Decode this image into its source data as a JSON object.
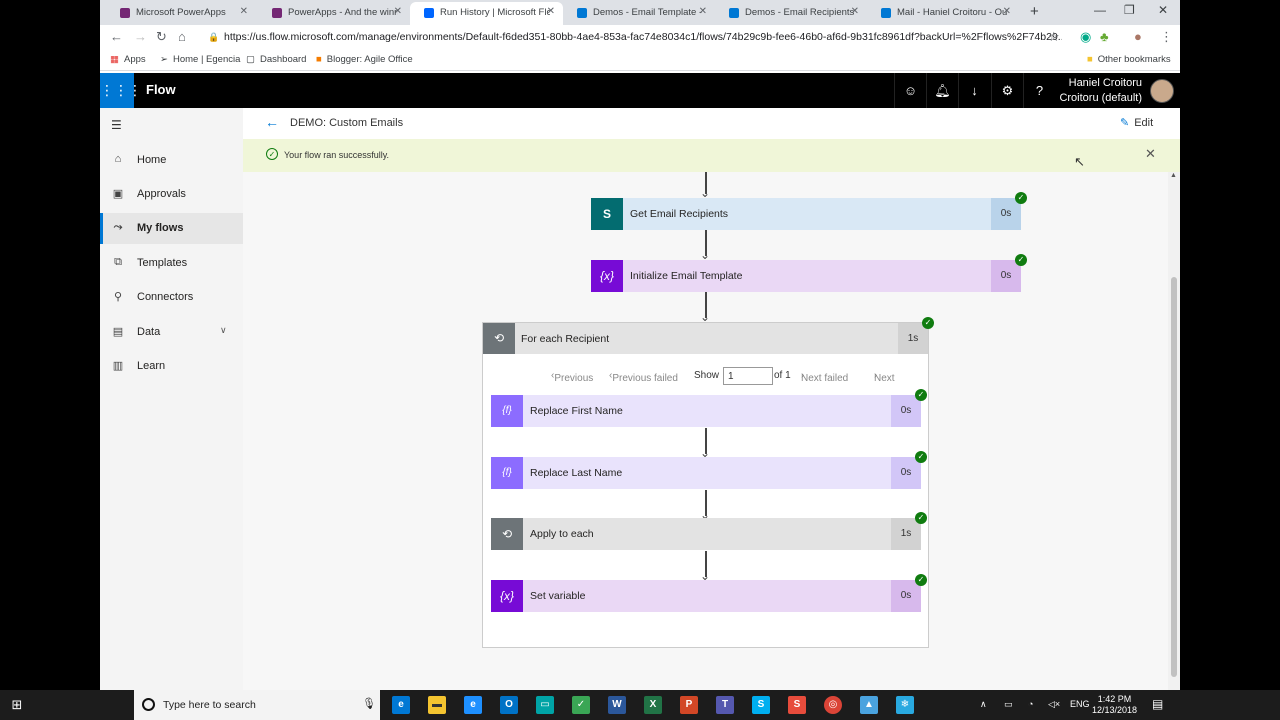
{
  "browser": {
    "tabs": [
      {
        "title": "Microsoft PowerApps",
        "color": "#742774"
      },
      {
        "title": "PowerApps - And the winne",
        "color": "#742774"
      },
      {
        "title": "Run History | Microsoft Flov",
        "color": "#0066ff",
        "active": true
      },
      {
        "title": "Demos - Email Template - A",
        "color": "#0078d4"
      },
      {
        "title": "Demos - Email Recipients",
        "color": "#0078d4"
      },
      {
        "title": "Mail - Haniel Croitoru - Out",
        "color": "#0078d4"
      }
    ],
    "new_tab": "+",
    "url": "https://us.flow.microsoft.com/manage/environments/Default-f6ded351-80bb-4ae4-853a-fac74e8034c1/flows/74b29c9b-fee6-46b0-af6d-9b31fc8961df?backUrl=%2Fflows%2F74b29...",
    "bookmarks": {
      "apps": "Apps",
      "home_egencia": "Home | Egencia",
      "dashboard": "Dashboard",
      "blogger": "Blogger: Agile Office",
      "other": "Other bookmarks"
    }
  },
  "header": {
    "app_name": "Flow",
    "user_name_line1": "Haniel Croitoru",
    "user_name_line2": "Croitoru (default)"
  },
  "nav": {
    "items": [
      {
        "label": "Home",
        "icon": "home-icon"
      },
      {
        "label": "Approvals",
        "icon": "approvals-icon"
      },
      {
        "label": "My flows",
        "icon": "flows-icon",
        "selected": true
      },
      {
        "label": "Templates",
        "icon": "templates-icon"
      },
      {
        "label": "Connectors",
        "icon": "connectors-icon"
      },
      {
        "label": "Data",
        "icon": "data-icon",
        "expandable": true
      },
      {
        "label": "Learn",
        "icon": "learn-icon"
      }
    ]
  },
  "main": {
    "title": "DEMO: Custom Emails",
    "edit_label": "Edit",
    "banner_message": "Your flow ran successfully."
  },
  "flow": {
    "steps": [
      {
        "label": "Get Email Recipients",
        "duration": "0s",
        "icon": "sharepoint-icon",
        "icon_color": "#036c70",
        "bg": "#d9e8f5",
        "dur_bg": "#b9d3ea"
      },
      {
        "label": "Initialize Email Template",
        "duration": "0s",
        "icon": "variable-icon",
        "icon_color": "#770bd6",
        "bg": "#ead8f5",
        "dur_bg": "#d7b9ec"
      }
    ],
    "foreach": {
      "label": "For each Recipient",
      "duration": "1s",
      "pager": {
        "previous": "Previous",
        "previous_failed": "Previous failed",
        "show": "Show",
        "page": "1",
        "of": "of 1",
        "next_failed": "Next failed",
        "next": "Next"
      },
      "steps": [
        {
          "label": "Replace First Name",
          "duration": "0s",
          "icon": "expression-icon",
          "icon_color": "#8c6cff",
          "bg": "#e9e3fc",
          "dur_bg": "#d2c6f7"
        },
        {
          "label": "Replace Last Name",
          "duration": "0s",
          "icon": "expression-icon",
          "icon_color": "#8c6cff",
          "bg": "#e9e3fc",
          "dur_bg": "#d2c6f7"
        },
        {
          "label": "Apply to each",
          "duration": "1s",
          "icon": "loop-icon",
          "icon_color": "#6d7478",
          "bg": "#e3e3e3",
          "dur_bg": "#d2d2d2"
        },
        {
          "label": "Set variable",
          "duration": "0s",
          "icon": "variable-icon",
          "icon_color": "#770bd6",
          "bg": "#ead8f5",
          "dur_bg": "#d7b9ec"
        }
      ]
    }
  },
  "taskbar": {
    "search_placeholder": "Type here to search",
    "lang": "ENG",
    "time": "1:42 PM",
    "date": "12/13/2018"
  }
}
